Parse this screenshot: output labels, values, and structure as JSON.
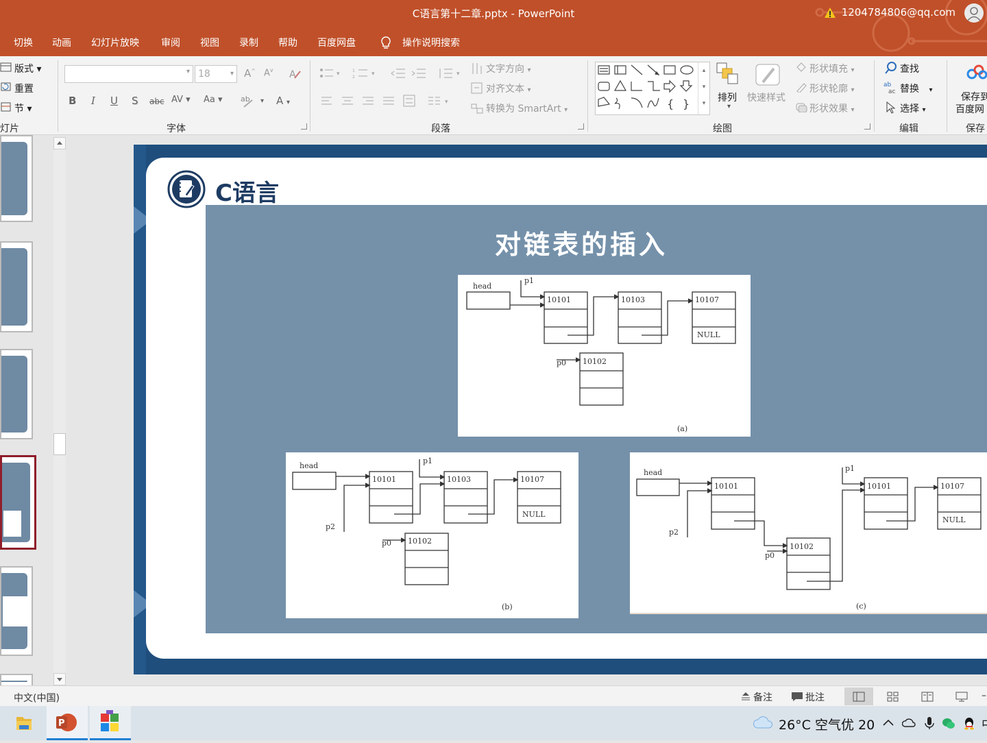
{
  "window": {
    "title": "C语言第十二章.pptx  -  PowerPoint",
    "account": "1204784806@qq.com"
  },
  "tabs": [
    "切换",
    "动画",
    "幻灯片放映",
    "审阅",
    "视图",
    "录制",
    "帮助",
    "百度网盘"
  ],
  "tell_me": "操作说明搜索",
  "ribbon": {
    "slides_group": {
      "layout": "版式",
      "reset": "重置",
      "section": "节",
      "label": "灯片"
    },
    "font_group": {
      "font_name": "",
      "font_size": "18",
      "bold": "B",
      "italic": "I",
      "underline": "U",
      "shadow": "S",
      "strike": "abc",
      "spacing": "AV",
      "case": "Aa",
      "color": "A",
      "label": "字体"
    },
    "paragraph_group": {
      "text_direction": "文字方向",
      "align_text": "对齐文本",
      "smartart": "转换为 SmartArt",
      "label": "段落"
    },
    "drawing_group": {
      "arrange": "排列",
      "quick_styles": "快速样式",
      "shape_fill": "形状填充",
      "shape_outline": "形状轮廓",
      "shape_effects": "形状效果",
      "label": "绘图"
    },
    "editing_group": {
      "find": "查找",
      "replace": "替换",
      "select": "选择",
      "label": "编辑"
    },
    "save_group": {
      "line1": "保存到",
      "line2": "百度网",
      "label": "保存"
    }
  },
  "slide": {
    "header": "C语言",
    "title": "对链表的插入",
    "figures": {
      "a": {
        "head": "head",
        "p1": "p1",
        "p0": "p0",
        "n1": "10101",
        "n2": "10103",
        "n3": "10107",
        "null": "NULL",
        "new": "10102",
        "caption": "(a)"
      },
      "b": {
        "head": "head",
        "p1": "p1",
        "p2": "p2",
        "p0": "p0",
        "n1": "10101",
        "n2": "10103",
        "n3": "10107",
        "null": "NULL",
        "new": "10102",
        "caption": "(b)"
      },
      "c": {
        "head": "head",
        "p1": "p1",
        "p2": "p2",
        "p0": "p0",
        "n1": "10101",
        "new": "10102",
        "n2": "10101",
        "n3": "10107",
        "null": "NULL",
        "caption": "(c)"
      }
    }
  },
  "statusbar": {
    "language": "中文(中国)",
    "notes": "备注",
    "comments": "批注"
  },
  "taskbar": {
    "weather": "26°C  空气优 20"
  },
  "colors": {
    "titlebar": "#c0502a",
    "slide_frame": "#1f4e7d",
    "content_bg": "#7591aa",
    "header_text": "#1e3c63"
  }
}
